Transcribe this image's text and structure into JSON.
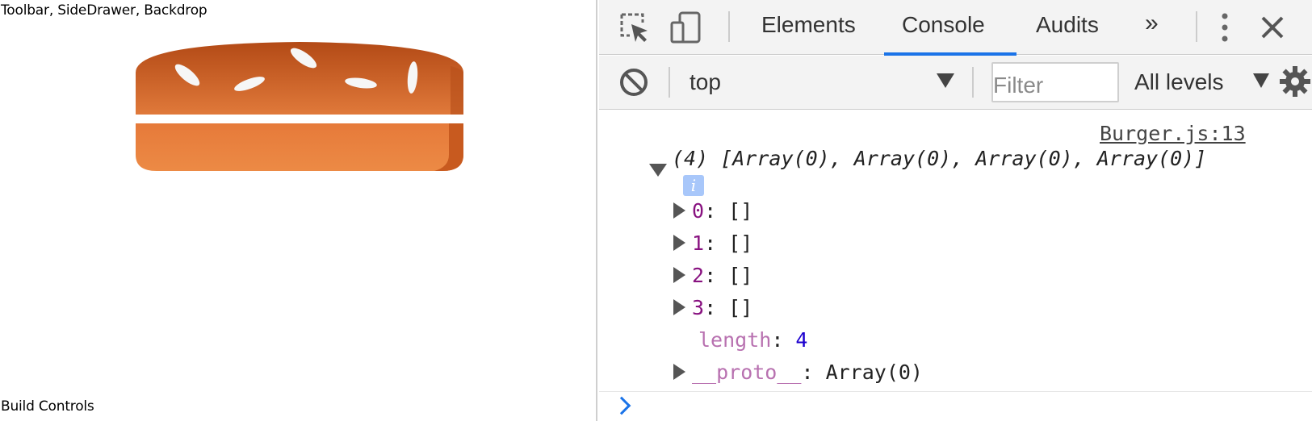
{
  "app": {
    "header_text": "Toolbar, SideDrawer, Backdrop",
    "footer_text": "Build Controls"
  },
  "devtools": {
    "tabs": [
      {
        "label": "Elements"
      },
      {
        "label": "Console",
        "active": true
      },
      {
        "label": "Audits"
      }
    ],
    "more_tabs_glyph": "»",
    "filterbar": {
      "context": "top",
      "filter_placeholder": "Filter",
      "levels_label": "All levels"
    },
    "console": {
      "source_link": "Burger.js:13",
      "summary": "(4) [Array(0), Array(0), Array(0), Array(0)]",
      "info_glyph": "i",
      "entries": [
        {
          "key": "0",
          "value": "[]"
        },
        {
          "key": "1",
          "value": "[]"
        },
        {
          "key": "2",
          "value": "[]"
        },
        {
          "key": "3",
          "value": "[]"
        }
      ],
      "length_key": "length",
      "length_value": "4",
      "proto_key": "__proto__",
      "proto_value": "Array(0)"
    }
  },
  "colors": {
    "accent": "#1a73e8",
    "bun_top": "#c0561f",
    "bun_bottom": "#e8803d",
    "key_purple": "#881280",
    "number_blue": "#1c00cf"
  },
  "icons": [
    "inspect-icon",
    "device-toggle-icon",
    "more-tabs-icon",
    "kebab-menu-icon",
    "close-icon",
    "clear-console-icon",
    "dropdown-arrow-icon",
    "settings-gear-icon",
    "info-icon",
    "expand-triangle-icon"
  ]
}
